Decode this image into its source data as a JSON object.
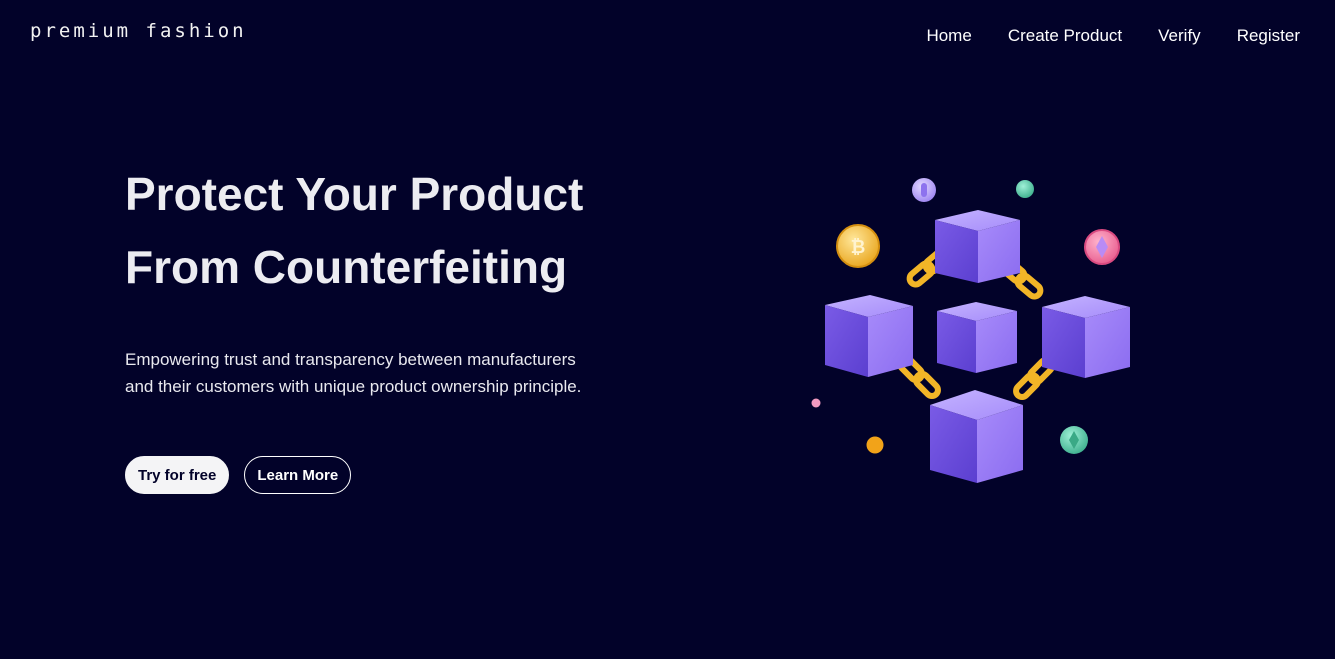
{
  "header": {
    "brand": "premium fashion",
    "nav": [
      "Home",
      "Create Product",
      "Verify",
      "Register"
    ]
  },
  "hero": {
    "title_lines": [
      "Protect Your Product",
      "From Counterfeiting"
    ],
    "subtitle_lines": [
      "Empowering trust and transparency between manufacturers",
      "and their customers with unique product ownership principle."
    ],
    "primary_button": "Try for free",
    "secondary_button": "Learn More"
  },
  "illustration": {
    "coin_symbols": [
      "₿"
    ],
    "icons": [
      "blockchain-cubes",
      "bitcoin-coin",
      "ethereum-coin",
      "chain-links"
    ]
  },
  "colors": {
    "background": "#020229",
    "cube_purple": "#8b6cf0",
    "chain_gold": "#f2b527",
    "coin_pink": "#f06b9b",
    "coin_teal": "#5ac9a8"
  }
}
